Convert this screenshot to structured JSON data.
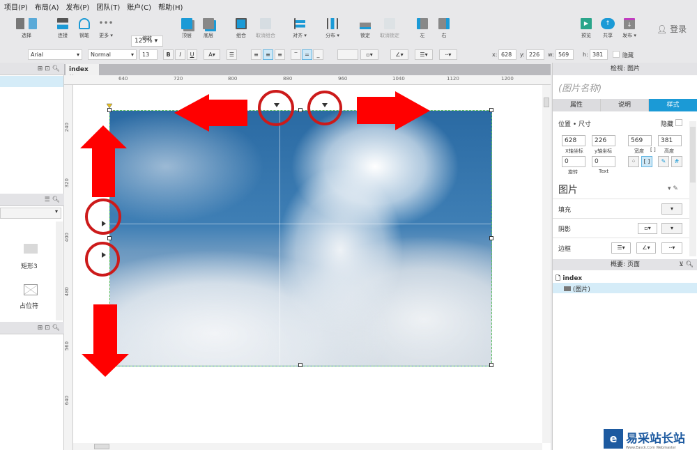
{
  "menu": [
    "项目(P)",
    "布局(A)",
    "发布(P)",
    "团队(T)",
    "账户(C)",
    "帮助(H)"
  ],
  "toolbar": {
    "select": "选择",
    "connect": "连接",
    "pen": "钢笔",
    "more": "更多 ▾",
    "zoom_value": "125%",
    "zoom_label": "缩放",
    "top": "顶层",
    "bottom": "底层",
    "group": "组合",
    "ungroup": "取消组合",
    "align": "对齐 ▾",
    "distribute": "分布 ▾",
    "lock": "锁定",
    "unlock": "取消锁定",
    "left": "左",
    "right": "右",
    "preview": "预览",
    "share": "共享",
    "publish": "发布 ▾",
    "login": "登录"
  },
  "format": {
    "font": "Arial",
    "weight": "Normal",
    "size": "13",
    "bold": "B",
    "italic": "I",
    "underline": "U",
    "x_label": "x:",
    "x": "628",
    "y_label": "y:",
    "y": "226",
    "w_label": "w:",
    "w": "569",
    "h_label": "h:",
    "h": "381",
    "hidden": "隐藏"
  },
  "left_panel": {
    "library_items": [
      "矩形3",
      "占位符"
    ]
  },
  "canvas": {
    "tab": "index",
    "ruler_h": [
      "640",
      "720",
      "800",
      "880",
      "960",
      "1040",
      "1120",
      "1200"
    ],
    "ruler_v": [
      "240",
      "320",
      "400",
      "480",
      "560",
      "640"
    ]
  },
  "inspector": {
    "title": "检视: 图片",
    "name_placeholder": "(图片名称)",
    "tabs": [
      "属性",
      "说明",
      "样式"
    ],
    "active_tab": "样式",
    "section": "位置 • 尺寸",
    "hidden": "隐藏",
    "x": "628",
    "y": "226",
    "w": "569",
    "h": "381",
    "x_cap": "X轴坐标",
    "y_cap": "y轴坐标",
    "w_cap": "宽度",
    "h_cap": "高度",
    "rotation": "0",
    "text_rotation": "0",
    "rot_cap": "旋转",
    "text_cap": "Text",
    "widget_type": "图片",
    "fill": "填充",
    "shadow": "阴影",
    "border": "边框"
  },
  "outline": {
    "title": "概要: 页面",
    "page": "index",
    "item": "(图片)"
  },
  "watermark": {
    "text": "易采站长站",
    "sub": "Www.Easck.Com Webmaster"
  },
  "colors": {
    "accent": "#1b9ad6",
    "annotation": "#ff0000",
    "circle": "#cc1a1a"
  }
}
